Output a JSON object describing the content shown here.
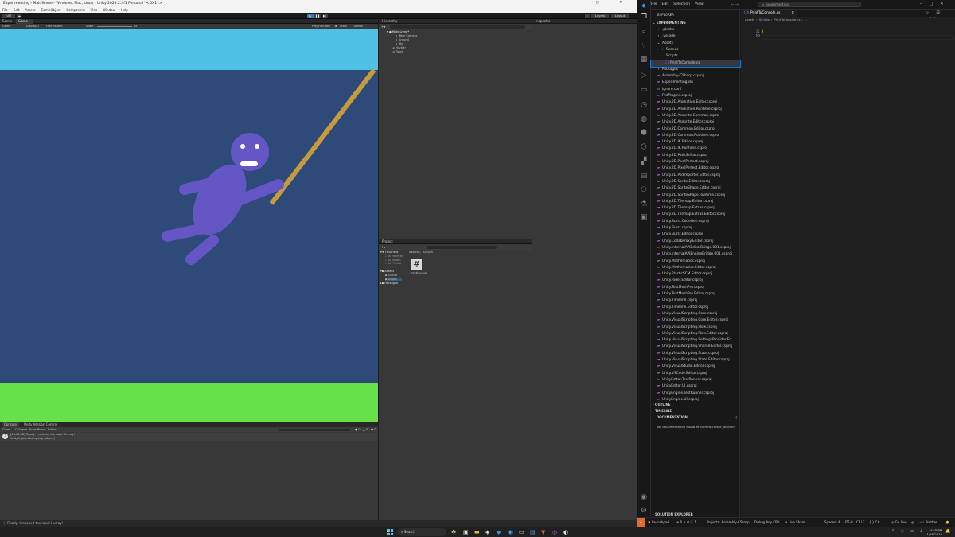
{
  "unity": {
    "title": "Experimenting - MainScene - Windows, Mac, Linux - Unity 2023.2.4f1 Personal* <DX11>",
    "menu": [
      "File",
      "Edit",
      "Assets",
      "GameObject",
      "Component",
      "Vids",
      "Window",
      "Help"
    ],
    "toolbar": {
      "account": "UN",
      "layers": "Layers",
      "layout": "Layout"
    },
    "tabs": {
      "scene": "Scene",
      "game": "Game"
    },
    "gamebar": {
      "mode": "Game",
      "display": "Display 1",
      "aspect": "Free Aspect",
      "scale": "Scale",
      "scale_val": "1x",
      "play": "Play Focused",
      "stats": "Stats",
      "gizmos": "Gizmos"
    },
    "hierarchy": {
      "tab": "Hierarchy",
      "scene": "MainScene*",
      "items": [
        "Main Camera",
        "Ground",
        "Sky",
        "Hurtler",
        "Rope"
      ]
    },
    "inspector": {
      "tab": "Inspector"
    },
    "project": {
      "tab": "Project",
      "favorites_label": "Favorites",
      "favorites": [
        "All Materials",
        "All Models",
        "All Prefabs"
      ],
      "assets_label": "Assets",
      "assets_children": [
        "Scenes",
        "Scripts"
      ],
      "packages_label": "Packages",
      "breadcrumb": [
        "Assets",
        "Scripts"
      ],
      "file_name": "PrintToConsole"
    },
    "console": {
      "tabs": [
        "Console",
        "Unity Version Control"
      ],
      "toolbar": [
        "Clear",
        "Collapse",
        "Error Pause",
        "Editor"
      ],
      "counts": [
        "0",
        "0",
        "0"
      ],
      "log_line1": "[18:03:38] Finally, I reached the rope! Hurray!",
      "log_line2": "UnityEngine.Debug:Log (object)"
    },
    "status": "Finally, I reached the rope! Hurray!",
    "colors": {
      "sky": "#4fc1e5",
      "bg": "#2d4a78",
      "ground": "#66e14a",
      "figure": "#6556c6",
      "rope": "#c69a3f"
    }
  },
  "vscode": {
    "search": "Experimenting",
    "menu": [
      "File",
      "Edit",
      "Selection",
      "View"
    ],
    "explorer_label": "EXPLORER",
    "root": "EXPERIMENTING",
    "tree": [
      {
        "name": ".plastic",
        "kind": "folder",
        "depth": 1,
        "color": "#cccccc"
      },
      {
        "name": ".vscode",
        "kind": "folder",
        "depth": 1,
        "color": "#cccccc"
      },
      {
        "name": "Assets",
        "kind": "folder-open",
        "depth": 1,
        "color": "#cccccc"
      },
      {
        "name": "Scenes",
        "kind": "folder",
        "depth": 2,
        "color": "#cccccc"
      },
      {
        "name": "Scripts",
        "kind": "folder-open",
        "depth": 2,
        "color": "#cccccc"
      },
      {
        "name": "PrintToConsole.cs",
        "kind": "cs",
        "depth": 3,
        "color": "#cccccc",
        "selected": true
      },
      {
        "name": "Packages",
        "kind": "folder",
        "depth": 1,
        "color": "#cccccc"
      },
      {
        "name": "Assembly-CSharp.csproj",
        "kind": "proj",
        "depth": 1,
        "color": "#cccccc"
      },
      {
        "name": "Experimenting.sln",
        "kind": "sln",
        "depth": 1,
        "color": "#cccccc"
      },
      {
        "name": "ignore.conf",
        "kind": "conf",
        "depth": 1,
        "color": "#cccccc"
      },
      {
        "name": "PsdPlugins.csproj",
        "kind": "proj",
        "depth": 1,
        "color": "#cccccc"
      },
      {
        "name": "Unity.2D.Animation.Editor.csproj",
        "kind": "proj",
        "depth": 1,
        "color": "#cccccc"
      },
      {
        "name": "Unity.2D.Animation.Runtime.csproj",
        "kind": "proj",
        "depth": 1,
        "color": "#cccccc"
      },
      {
        "name": "Unity.2D.Aseprite.Common.csproj",
        "kind": "proj",
        "depth": 1,
        "color": "#cccccc"
      },
      {
        "name": "Unity.2D.Aseprite.Editor.csproj",
        "kind": "proj",
        "depth": 1,
        "color": "#cccccc"
      },
      {
        "name": "Unity.2D.Common.Editor.csproj",
        "kind": "proj",
        "depth": 1,
        "color": "#cccccc"
      },
      {
        "name": "Unity.2D.Common.Runtime.csproj",
        "kind": "proj",
        "depth": 1,
        "color": "#cccccc"
      },
      {
        "name": "Unity.2D.IK.Editor.csproj",
        "kind": "proj",
        "depth": 1,
        "color": "#cccccc"
      },
      {
        "name": "Unity.2D.IK.Runtime.csproj",
        "kind": "proj",
        "depth": 1,
        "color": "#cccccc"
      },
      {
        "name": "Unity.2D.Path.Editor.csproj",
        "kind": "proj",
        "depth": 1,
        "color": "#cccccc"
      },
      {
        "name": "Unity.2D.PixelPerfect.csproj",
        "kind": "proj",
        "depth": 1,
        "color": "#cccccc"
      },
      {
        "name": "Unity.2D.PixelPerfect.Editor.csproj",
        "kind": "proj",
        "depth": 1,
        "color": "#cccccc"
      },
      {
        "name": "Unity.2D.PsdImporter.Editor.csproj",
        "kind": "proj",
        "depth": 1,
        "color": "#cccccc"
      },
      {
        "name": "Unity.2D.Sprite.Editor.csproj",
        "kind": "proj",
        "depth": 1,
        "color": "#cccccc"
      },
      {
        "name": "Unity.2D.SpriteShape.Editor.csproj",
        "kind": "proj",
        "depth": 1,
        "color": "#cccccc"
      },
      {
        "name": "Unity.2D.SpriteShape.Runtime.csproj",
        "kind": "proj",
        "depth": 1,
        "color": "#cccccc"
      },
      {
        "name": "Unity.2D.Tilemap.Editor.csproj",
        "kind": "proj",
        "depth": 1,
        "color": "#cccccc"
      },
      {
        "name": "Unity.2D.Tilemap.Extras.csproj",
        "kind": "proj",
        "depth": 1,
        "color": "#cccccc"
      },
      {
        "name": "Unity.2D.Tilemap.Extras.Editor.csproj",
        "kind": "proj",
        "depth": 1,
        "color": "#cccccc"
      },
      {
        "name": "Unity.Burst.CodeGen.csproj",
        "kind": "proj",
        "depth": 1,
        "color": "#cccccc"
      },
      {
        "name": "Unity.Burst.csproj",
        "kind": "proj",
        "depth": 1,
        "color": "#cccccc"
      },
      {
        "name": "Unity.Burst.Editor.csproj",
        "kind": "proj",
        "depth": 1,
        "color": "#cccccc"
      },
      {
        "name": "Unity.CollabProxy.Editor.csproj",
        "kind": "proj",
        "depth": 1,
        "color": "#cccccc"
      },
      {
        "name": "Unity.InternalAPIEditorBridge.001.csproj",
        "kind": "proj",
        "depth": 1,
        "color": "#cccccc"
      },
      {
        "name": "Unity.InternalAPIEngineBridge.001.csproj",
        "kind": "proj",
        "depth": 1,
        "color": "#cccccc"
      },
      {
        "name": "Unity.Mathematics.csproj",
        "kind": "proj",
        "depth": 1,
        "color": "#cccccc"
      },
      {
        "name": "Unity.Mathematics.Editor.csproj",
        "kind": "proj",
        "depth": 1,
        "color": "#cccccc"
      },
      {
        "name": "Unity.PlasticSCM.Editor.csproj",
        "kind": "proj",
        "depth": 1,
        "color": "#cccccc"
      },
      {
        "name": "Unity.Rider.Editor.csproj",
        "kind": "proj",
        "depth": 1,
        "color": "#cccccc"
      },
      {
        "name": "Unity.TextMeshPro.csproj",
        "kind": "proj",
        "depth": 1,
        "color": "#cccccc"
      },
      {
        "name": "Unity.TextMeshPro.Editor.csproj",
        "kind": "proj",
        "depth": 1,
        "color": "#cccccc"
      },
      {
        "name": "Unity.Timeline.csproj",
        "kind": "proj",
        "depth": 1,
        "color": "#cccccc"
      },
      {
        "name": "Unity.Timeline.Editor.csproj",
        "kind": "proj",
        "depth": 1,
        "color": "#cccccc"
      },
      {
        "name": "Unity.VisualScripting.Core.csproj",
        "kind": "proj",
        "depth": 1,
        "color": "#cccccc"
      },
      {
        "name": "Unity.VisualScripting.Core.Editor.csproj",
        "kind": "proj",
        "depth": 1,
        "color": "#cccccc"
      },
      {
        "name": "Unity.VisualScripting.Flow.csproj",
        "kind": "proj",
        "depth": 1,
        "color": "#cccccc"
      },
      {
        "name": "Unity.VisualScripting.Flow.Editor.csproj",
        "kind": "proj",
        "depth": 1,
        "color": "#cccccc"
      },
      {
        "name": "Unity.VisualScripting.SettingsProvider.Ed...",
        "kind": "proj",
        "depth": 1,
        "color": "#cccccc"
      },
      {
        "name": "Unity.VisualScripting.Shared.Editor.csproj",
        "kind": "proj",
        "depth": 1,
        "color": "#cccccc"
      },
      {
        "name": "Unity.VisualScripting.State.csproj",
        "kind": "proj",
        "depth": 1,
        "color": "#cccccc"
      },
      {
        "name": "Unity.VisualScripting.State.Editor.csproj",
        "kind": "proj",
        "depth": 1,
        "color": "#cccccc"
      },
      {
        "name": "Unity.VisualStudio.Editor.csproj",
        "kind": "proj",
        "depth": 1,
        "color": "#cccccc"
      },
      {
        "name": "Unity.VSCode.Editor.csproj",
        "kind": "proj",
        "depth": 1,
        "color": "#cccccc"
      },
      {
        "name": "UnityEditor.TestRunner.csproj",
        "kind": "proj",
        "depth": 1,
        "color": "#cccccc"
      },
      {
        "name": "UnityEditor.UI.csproj",
        "kind": "proj",
        "depth": 1,
        "color": "#cccccc"
      },
      {
        "name": "UnityEngine.TestRunner.csproj",
        "kind": "proj",
        "depth": 1,
        "color": "#cccccc"
      },
      {
        "name": "UnityEngine.UI.csproj",
        "kind": "proj",
        "depth": 1,
        "color": "#cccccc"
      }
    ],
    "sections": [
      "OUTLINE",
      "TIMELINE",
      "DOCUMENTATION"
    ],
    "doc_text": "No documentation found at current cursor position",
    "solution_explorer": "SOLUTION EXPLORER",
    "editor": {
      "tab": "PrintToConsole.cs",
      "breadcrumb": [
        "Assets",
        "Scripts",
        "PrintToConsole.cs",
        "..."
      ],
      "line_numbers": [
        "11",
        "12"
      ],
      "code": "}"
    },
    "status": {
      "launchpad": "Launchpad",
      "errors": "0",
      "warnings": "0",
      "info": "1",
      "project": "Projects: Assembly-CSharp",
      "config": "Debug Any CPU",
      "liveshare": "Live Share",
      "spaces": "Spaces: 4",
      "encoding": "UTF-8",
      "eol": "CRLF",
      "lang": "C#",
      "golive": "Go Live",
      "prettier": "Prettier"
    }
  },
  "taskbar": {
    "search": "Search",
    "time": "4:55 PM",
    "date": "1/28/2025"
  }
}
